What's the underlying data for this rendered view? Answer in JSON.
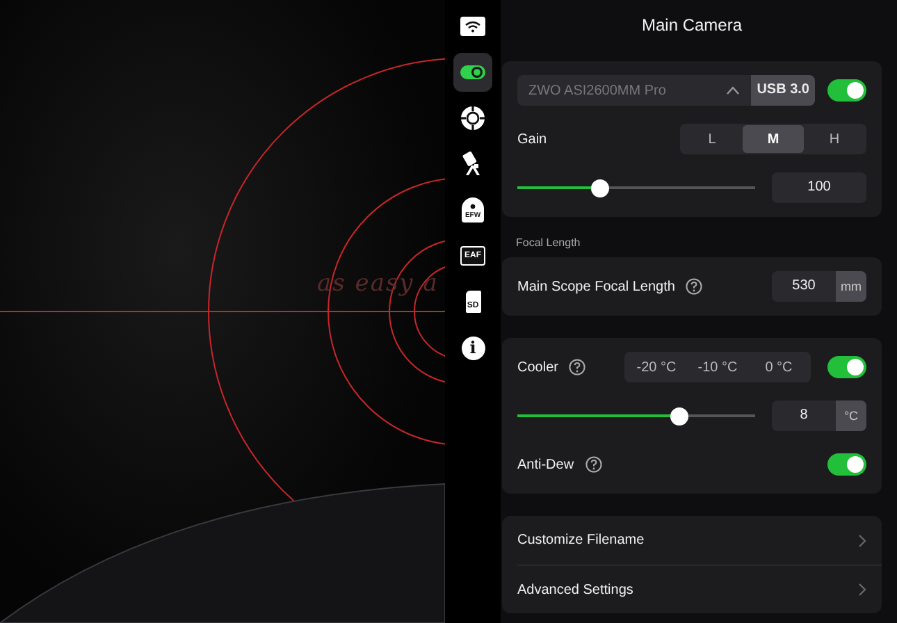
{
  "preview": {
    "overlay_text": "as easy a"
  },
  "sidebar": {
    "items": [
      {
        "kind": "wifi",
        "selected": false
      },
      {
        "kind": "camera",
        "selected": true
      },
      {
        "kind": "guide",
        "selected": false
      },
      {
        "kind": "mount",
        "selected": false
      },
      {
        "kind": "badge",
        "label": "EFW",
        "selected": false
      },
      {
        "kind": "chip",
        "label": "EAF",
        "selected": false
      },
      {
        "kind": "card",
        "label": "SD",
        "selected": false
      },
      {
        "kind": "info",
        "label": "i",
        "selected": false
      }
    ]
  },
  "panel": {
    "title": "Main Camera",
    "camera": {
      "name": "ZWO ASI2600MM Pro",
      "connection": "USB 3.0",
      "on": true
    },
    "gain": {
      "label": "Gain",
      "presets": [
        {
          "label": "L",
          "selected": false
        },
        {
          "label": "M",
          "selected": true
        },
        {
          "label": "H",
          "selected": false
        }
      ],
      "level": 0.345,
      "value": "100"
    },
    "focal_section": "Focal Length",
    "focal": {
      "label": "Main Scope Focal Length",
      "help": true,
      "value": "530",
      "unit": "mm"
    },
    "cooler": {
      "label": "Cooler",
      "help": true,
      "presets": [
        {
          "label": "-20 °C",
          "selected": false
        },
        {
          "label": "-10 °C",
          "selected": false
        },
        {
          "label": "0 °C",
          "selected": false
        }
      ],
      "on": true,
      "level": 0.68,
      "value": "8",
      "unit": "°C"
    },
    "anti_dew": {
      "label": "Anti-Dew",
      "help": true,
      "on": true
    },
    "links": [
      {
        "label": "Customize Filename"
      },
      {
        "label": "Advanced Settings"
      }
    ]
  }
}
